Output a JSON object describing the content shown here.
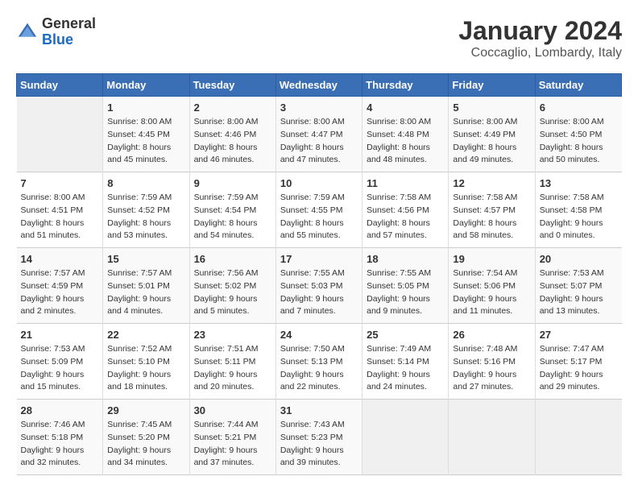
{
  "header": {
    "logo": {
      "general": "General",
      "blue": "Blue"
    },
    "title": "January 2024",
    "subtitle": "Coccaglio, Lombardy, Italy"
  },
  "calendar": {
    "days_of_week": [
      "Sunday",
      "Monday",
      "Tuesday",
      "Wednesday",
      "Thursday",
      "Friday",
      "Saturday"
    ],
    "weeks": [
      [
        {
          "day": "",
          "info": ""
        },
        {
          "day": "1",
          "info": "Sunrise: 8:00 AM\nSunset: 4:45 PM\nDaylight: 8 hours\nand 45 minutes."
        },
        {
          "day": "2",
          "info": "Sunrise: 8:00 AM\nSunset: 4:46 PM\nDaylight: 8 hours\nand 46 minutes."
        },
        {
          "day": "3",
          "info": "Sunrise: 8:00 AM\nSunset: 4:47 PM\nDaylight: 8 hours\nand 47 minutes."
        },
        {
          "day": "4",
          "info": "Sunrise: 8:00 AM\nSunset: 4:48 PM\nDaylight: 8 hours\nand 48 minutes."
        },
        {
          "day": "5",
          "info": "Sunrise: 8:00 AM\nSunset: 4:49 PM\nDaylight: 8 hours\nand 49 minutes."
        },
        {
          "day": "6",
          "info": "Sunrise: 8:00 AM\nSunset: 4:50 PM\nDaylight: 8 hours\nand 50 minutes."
        }
      ],
      [
        {
          "day": "7",
          "info": "Sunrise: 8:00 AM\nSunset: 4:51 PM\nDaylight: 8 hours\nand 51 minutes."
        },
        {
          "day": "8",
          "info": "Sunrise: 7:59 AM\nSunset: 4:52 PM\nDaylight: 8 hours\nand 53 minutes."
        },
        {
          "day": "9",
          "info": "Sunrise: 7:59 AM\nSunset: 4:54 PM\nDaylight: 8 hours\nand 54 minutes."
        },
        {
          "day": "10",
          "info": "Sunrise: 7:59 AM\nSunset: 4:55 PM\nDaylight: 8 hours\nand 55 minutes."
        },
        {
          "day": "11",
          "info": "Sunrise: 7:58 AM\nSunset: 4:56 PM\nDaylight: 8 hours\nand 57 minutes."
        },
        {
          "day": "12",
          "info": "Sunrise: 7:58 AM\nSunset: 4:57 PM\nDaylight: 8 hours\nand 58 minutes."
        },
        {
          "day": "13",
          "info": "Sunrise: 7:58 AM\nSunset: 4:58 PM\nDaylight: 9 hours\nand 0 minutes."
        }
      ],
      [
        {
          "day": "14",
          "info": "Sunrise: 7:57 AM\nSunset: 4:59 PM\nDaylight: 9 hours\nand 2 minutes."
        },
        {
          "day": "15",
          "info": "Sunrise: 7:57 AM\nSunset: 5:01 PM\nDaylight: 9 hours\nand 4 minutes."
        },
        {
          "day": "16",
          "info": "Sunrise: 7:56 AM\nSunset: 5:02 PM\nDaylight: 9 hours\nand 5 minutes."
        },
        {
          "day": "17",
          "info": "Sunrise: 7:55 AM\nSunset: 5:03 PM\nDaylight: 9 hours\nand 7 minutes."
        },
        {
          "day": "18",
          "info": "Sunrise: 7:55 AM\nSunset: 5:05 PM\nDaylight: 9 hours\nand 9 minutes."
        },
        {
          "day": "19",
          "info": "Sunrise: 7:54 AM\nSunset: 5:06 PM\nDaylight: 9 hours\nand 11 minutes."
        },
        {
          "day": "20",
          "info": "Sunrise: 7:53 AM\nSunset: 5:07 PM\nDaylight: 9 hours\nand 13 minutes."
        }
      ],
      [
        {
          "day": "21",
          "info": "Sunrise: 7:53 AM\nSunset: 5:09 PM\nDaylight: 9 hours\nand 15 minutes."
        },
        {
          "day": "22",
          "info": "Sunrise: 7:52 AM\nSunset: 5:10 PM\nDaylight: 9 hours\nand 18 minutes."
        },
        {
          "day": "23",
          "info": "Sunrise: 7:51 AM\nSunset: 5:11 PM\nDaylight: 9 hours\nand 20 minutes."
        },
        {
          "day": "24",
          "info": "Sunrise: 7:50 AM\nSunset: 5:13 PM\nDaylight: 9 hours\nand 22 minutes."
        },
        {
          "day": "25",
          "info": "Sunrise: 7:49 AM\nSunset: 5:14 PM\nDaylight: 9 hours\nand 24 minutes."
        },
        {
          "day": "26",
          "info": "Sunrise: 7:48 AM\nSunset: 5:16 PM\nDaylight: 9 hours\nand 27 minutes."
        },
        {
          "day": "27",
          "info": "Sunrise: 7:47 AM\nSunset: 5:17 PM\nDaylight: 9 hours\nand 29 minutes."
        }
      ],
      [
        {
          "day": "28",
          "info": "Sunrise: 7:46 AM\nSunset: 5:18 PM\nDaylight: 9 hours\nand 32 minutes."
        },
        {
          "day": "29",
          "info": "Sunrise: 7:45 AM\nSunset: 5:20 PM\nDaylight: 9 hours\nand 34 minutes."
        },
        {
          "day": "30",
          "info": "Sunrise: 7:44 AM\nSunset: 5:21 PM\nDaylight: 9 hours\nand 37 minutes."
        },
        {
          "day": "31",
          "info": "Sunrise: 7:43 AM\nSunset: 5:23 PM\nDaylight: 9 hours\nand 39 minutes."
        },
        {
          "day": "",
          "info": ""
        },
        {
          "day": "",
          "info": ""
        },
        {
          "day": "",
          "info": ""
        }
      ]
    ]
  }
}
